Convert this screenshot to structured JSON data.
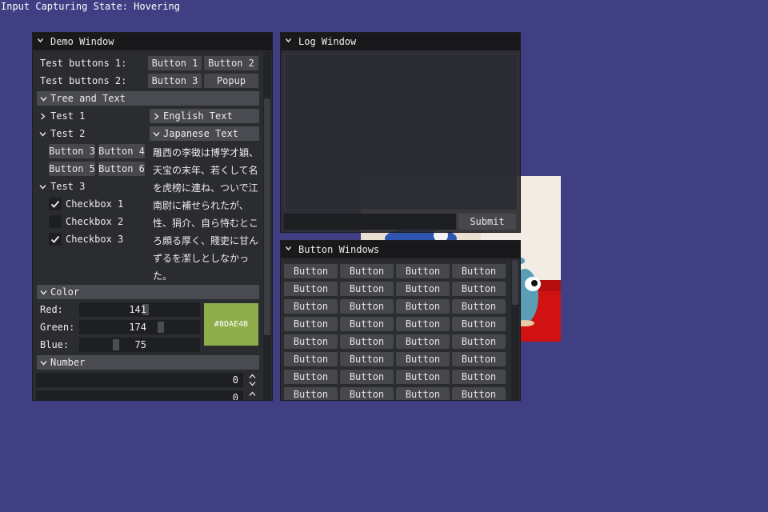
{
  "status": "Input Capturing State: Hovering",
  "demo": {
    "title": "Demo Window",
    "row1_label": "Test buttons 1:",
    "row1_buttons": [
      "Button 1",
      "Button 2"
    ],
    "row2_label": "Test buttons 2:",
    "row2_buttons": [
      "Button 3",
      "Popup"
    ],
    "tree_header": "Tree and Text",
    "test1": "Test 1",
    "test2": "Test 2",
    "test2_buttons": [
      "Button 3",
      "Button 4",
      "Button 5",
      "Button 6"
    ],
    "test3": "Test 3",
    "checkboxes": [
      {
        "label": "Checkbox 1",
        "checked": true
      },
      {
        "label": "Checkbox 2",
        "checked": false
      },
      {
        "label": "Checkbox 3",
        "checked": true
      }
    ],
    "english": "English Text",
    "japanese": "Japanese Text",
    "jp_lines": [
      "雕西の李徴は博学才穎、",
      "天宝の末年、若くして名",
      "を虎榜に連ね、ついで江",
      "南尉に補せられたが、",
      "性、狷介、自ら恃むとこ",
      "ろ頗る厚く、賤吏に甘ん",
      "ずるを潔しとしなかっ",
      "た。"
    ],
    "color_header": "Color",
    "red_label": "Red:",
    "green_label": "Green:",
    "blue_label": "Blue:",
    "red_value": "141",
    "green_value": "174",
    "blue_value": "75",
    "red_fraction": 0.553,
    "green_fraction": 0.682,
    "blue_fraction": 0.294,
    "swatch_hex": "#8DAE4B",
    "swatch_color": "#8dae4b",
    "number_header": "Number",
    "number1": "0",
    "number2": "0"
  },
  "log": {
    "title": "Log Window",
    "input_value": "",
    "submit": "Submit"
  },
  "buttons_window": {
    "title": "Button Windows",
    "button_label": "Button",
    "rows": 8,
    "cols": 4
  },
  "colors": {
    "background": "#413f83",
    "window_bg": "#2b2c30",
    "titlebar": "#19191b",
    "button": "#47484e"
  }
}
